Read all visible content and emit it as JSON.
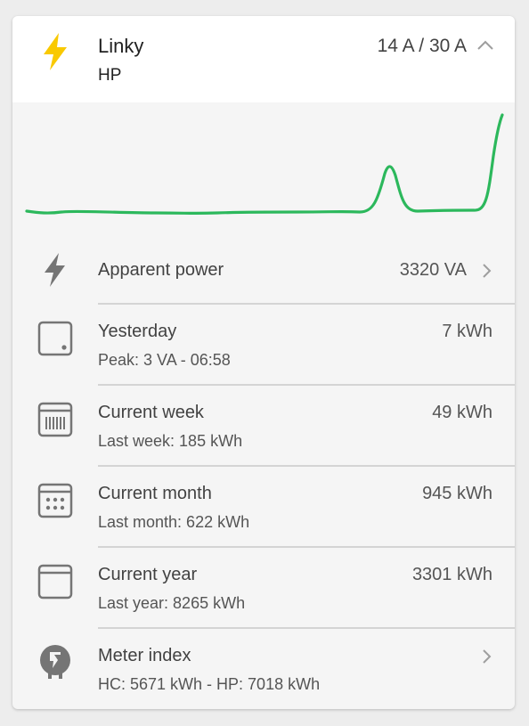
{
  "header": {
    "title": "Linky",
    "subtitle": "HP",
    "current": "14 A / 30 A",
    "icon": "lightning-bolt-icon",
    "accent": "#f9c900"
  },
  "graph": {
    "line_color": "#2cb85c",
    "trend": [
      0.06,
      0.05,
      0.06,
      0.06,
      0.06,
      0.06,
      0.05,
      0.06,
      0.06,
      0.06,
      0.06,
      0.06,
      0.06,
      0.06,
      0.52,
      0.06,
      0.06,
      0.06,
      1.0
    ]
  },
  "rows": [
    {
      "label": "Apparent power",
      "sub": "",
      "value": "3320 VA",
      "icon": "lightning-bolt-icon",
      "has_arrow": true
    },
    {
      "label": "Yesterday",
      "sub": "Peak: 3 VA - 06:58",
      "value": "7 kWh",
      "icon": "calendar-day-icon",
      "has_arrow": false
    },
    {
      "label": "Current week",
      "sub": "Last week: 185 kWh",
      "value": "49 kWh",
      "icon": "calendar-week-icon",
      "has_arrow": false
    },
    {
      "label": "Current month",
      "sub": "Last month: 622 kWh",
      "value": "945 kWh",
      "icon": "calendar-month-icon",
      "has_arrow": false
    },
    {
      "label": "Current year",
      "sub": "Last year: 8265 kWh",
      "value": "3301 kWh",
      "icon": "calendar-year-icon",
      "has_arrow": false
    },
    {
      "label": "Meter index",
      "sub": "HC: 5671 kWh - HP: 7018 kWh",
      "value": "",
      "icon": "meter-icon",
      "has_arrow": true
    }
  ]
}
